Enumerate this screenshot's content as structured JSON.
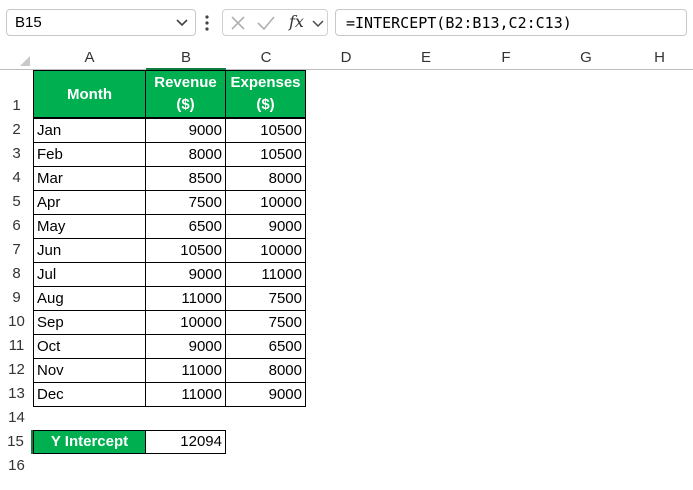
{
  "name_box": "B15",
  "formula_bar": {
    "fx_label": "fx",
    "formula": "=INTERCEPT(B2:B13,C2:C13)"
  },
  "columns": [
    "A",
    "B",
    "C",
    "D",
    "E",
    "F",
    "G",
    "H"
  ],
  "rows": [
    "1",
    "2",
    "3",
    "4",
    "5",
    "6",
    "7",
    "8",
    "9",
    "10",
    "11",
    "12",
    "13",
    "14",
    "15",
    "16"
  ],
  "table": {
    "headers": {
      "month": "Month",
      "revenue_line1": "Revenue",
      "revenue_line2": "($)",
      "expenses_line1": "Expenses",
      "expenses_line2": "($)"
    },
    "data": [
      {
        "month": "Jan",
        "revenue": "9000",
        "expenses": "10500"
      },
      {
        "month": "Feb",
        "revenue": "8000",
        "expenses": "10500"
      },
      {
        "month": "Mar",
        "revenue": "8500",
        "expenses": "8000"
      },
      {
        "month": "Apr",
        "revenue": "7500",
        "expenses": "10000"
      },
      {
        "month": "May",
        "revenue": "6500",
        "expenses": "9000"
      },
      {
        "month": "Jun",
        "revenue": "10500",
        "expenses": "10000"
      },
      {
        "month": "Jul",
        "revenue": "9000",
        "expenses": "11000"
      },
      {
        "month": "Aug",
        "revenue": "11000",
        "expenses": "7500"
      },
      {
        "month": "Sep",
        "revenue": "10000",
        "expenses": "7500"
      },
      {
        "month": "Oct",
        "revenue": "9000",
        "expenses": "6500"
      },
      {
        "month": "Nov",
        "revenue": "11000",
        "expenses": "8000"
      },
      {
        "month": "Dec",
        "revenue": "11000",
        "expenses": "9000"
      }
    ]
  },
  "intercept": {
    "label": "Y Intercept",
    "value": "12094"
  },
  "colors": {
    "header_green": "#00b050",
    "grid_line": "#bdbdbd"
  }
}
